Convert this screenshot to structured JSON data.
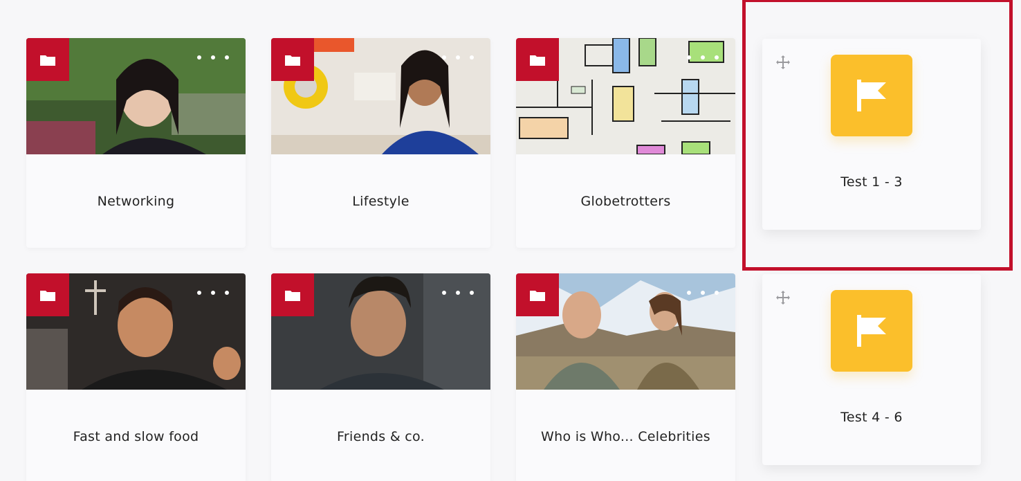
{
  "colors": {
    "accent_red": "#c2102b",
    "flag_yellow": "#fbbf2b",
    "card_bg": "#fafafc",
    "page_bg": "#f7f7f9",
    "text": "#222222"
  },
  "folder_cards": [
    {
      "title": "Networking",
      "icon": "folder-icon",
      "menu_icon": "more-icon"
    },
    {
      "title": "Lifestyle",
      "icon": "folder-icon",
      "menu_icon": "more-icon"
    },
    {
      "title": "Globetrotters",
      "icon": "folder-icon",
      "menu_icon": "more-icon"
    },
    {
      "title": "Fast and slow food",
      "icon": "folder-icon",
      "menu_icon": "more-icon"
    },
    {
      "title": "Friends & co.",
      "icon": "folder-icon",
      "menu_icon": "more-icon"
    },
    {
      "title": "Who is Who... Celebrities",
      "icon": "folder-icon",
      "menu_icon": "more-icon"
    }
  ],
  "test_cards": [
    {
      "title": "Test 1 - 3",
      "icon": "flag-icon",
      "drag_icon": "move-icon"
    },
    {
      "title": "Test 4 - 6",
      "icon": "flag-icon",
      "drag_icon": "move-icon"
    }
  ]
}
